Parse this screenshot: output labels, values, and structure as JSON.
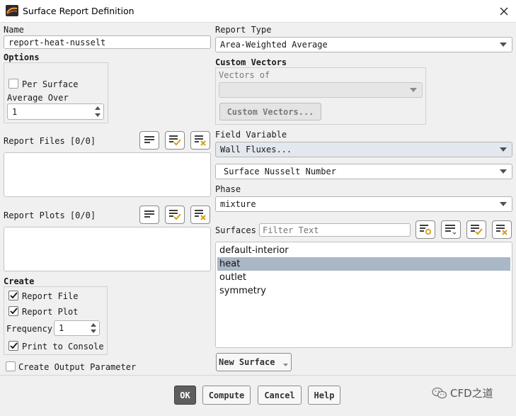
{
  "window": {
    "title": "Surface Report Definition",
    "close_icon": "close-icon"
  },
  "name": {
    "label": "Name",
    "value": "report-heat-nusselt"
  },
  "options": {
    "label": "Options",
    "per_surface_label": "Per Surface",
    "per_surface_checked": false,
    "average_over_label": "Average Over",
    "average_over_value": "1"
  },
  "report_files": {
    "label": "Report Files [0/0]"
  },
  "report_plots": {
    "label": "Report Plots [0/0]"
  },
  "create": {
    "label": "Create",
    "report_file_label": "Report File",
    "report_file_checked": true,
    "report_plot_label": "Report Plot",
    "report_plot_checked": true,
    "frequency_label": "Frequency",
    "frequency_value": "1",
    "print_to_console_label": "Print to Console",
    "print_to_console_checked": true
  },
  "create_output_parameter": {
    "label": "Create Output Parameter",
    "checked": false
  },
  "report_type": {
    "label": "Report Type",
    "value": "Area-Weighted Average"
  },
  "custom_vectors": {
    "label": "Custom Vectors",
    "vectors_of_label": "Vectors of",
    "vectors_of_value": "",
    "button_label": "Custom Vectors..."
  },
  "field_variable": {
    "label": "Field Variable",
    "category_value": "Wall Fluxes...",
    "variable_value": "Surface Nusselt Number"
  },
  "phase": {
    "label": "Phase",
    "value": "mixture"
  },
  "surfaces": {
    "label": "Surfaces",
    "filter_placeholder": "Filter Text",
    "items": [
      {
        "label": "default-interior",
        "selected": false
      },
      {
        "label": "heat",
        "selected": true
      },
      {
        "label": "outlet",
        "selected": false
      },
      {
        "label": "symmetry",
        "selected": false
      }
    ],
    "new_surface_label": "New Surface"
  },
  "buttons": {
    "ok": "OK",
    "compute": "Compute",
    "cancel": "Cancel",
    "help": "Help"
  },
  "watermark": {
    "text": "CFD之道"
  },
  "colors": {
    "selection": "#a9b7c6",
    "primary_button": "#5e5e5e",
    "check_accent": "#d4a017",
    "delete_accent": "#d4a017"
  }
}
